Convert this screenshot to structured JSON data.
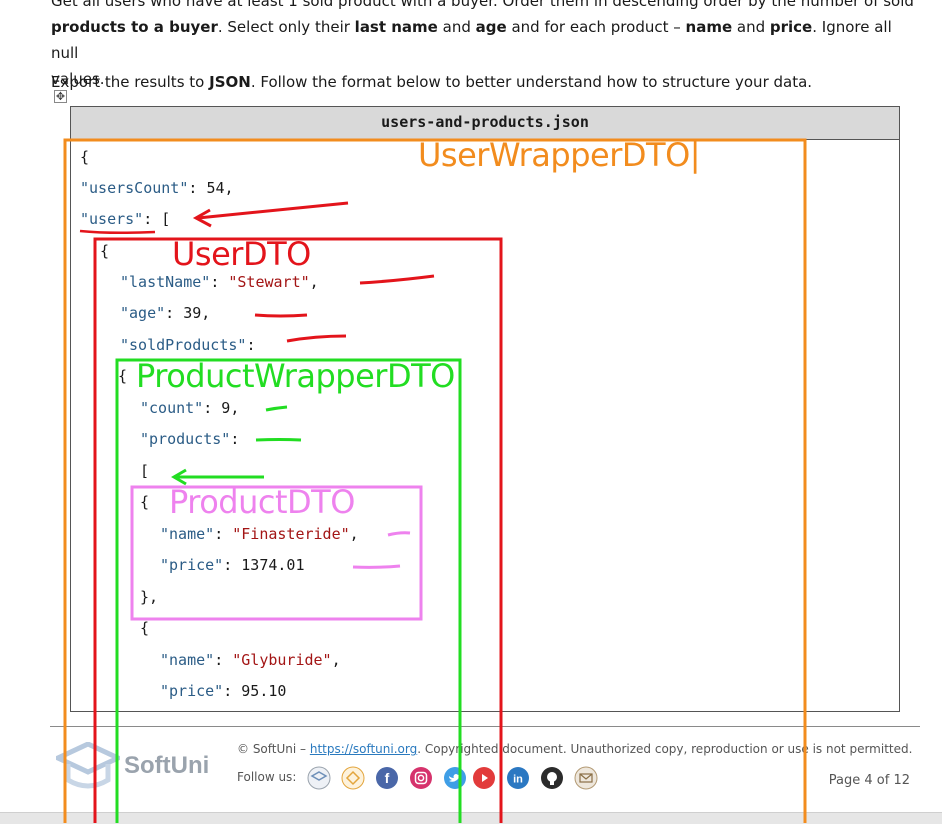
{
  "intro": {
    "line1_prefix": "Get all users who have at least 1 sold product with a buyer. Order them in descending order by the number of sold",
    "line2_bold": "products to a buyer",
    "line2_mid1": ". Select only their ",
    "bold_lastname": "last name",
    "mid2": " and ",
    "bold_age": "age",
    "mid3": " and for each product – ",
    "bold_name": "name",
    "mid4": " and ",
    "bold_price": "price",
    "line2_end": ". Ignore all null",
    "line3": "values."
  },
  "export": {
    "prefix": "Export the results to ",
    "bold": "JSON",
    "suffix": ". Follow the format below to better understand how to structure your data."
  },
  "move_handle_glyph": "✥",
  "code": {
    "filename": "users-and-products.json",
    "lines": {
      "l1": "{",
      "l2_key": "\"usersCount\"",
      "l2_val": "54",
      "l3_key": "\"users\"",
      "l3_rest": ": [",
      "l4": "{",
      "l5_key": "\"lastName\"",
      "l5_val": "\"Stewart\"",
      "l6_key": "\"age\"",
      "l6_val": "39",
      "l7_key": "\"soldProducts\"",
      "l8": "{",
      "l9_key": "\"count\"",
      "l9_val": "9",
      "l10_key": "\"products\"",
      "l11": "[",
      "l12": "{",
      "l13_key": "\"name\"",
      "l13_val": "\"Finasteride\"",
      "l14_key": "\"price\"",
      "l14_val": "1374.01",
      "l15": "},",
      "l16": "{",
      "l17_key": "\"name\"",
      "l17_val": "\"Glyburide\"",
      "l18_key": "\"price\"",
      "l18_val": "95.10"
    }
  },
  "annotations": {
    "user_wrapper": "UserWrapperDTO|",
    "user": "UserDTO",
    "product_wrapper": "ProductWrapperDTO",
    "product": "ProductDTO",
    "colors": {
      "orange": "#f28c1e",
      "red": "#e3141b",
      "green": "#22dd22",
      "pink": "#ee82ee"
    }
  },
  "footer": {
    "logo": "SoftUni",
    "copyright_prefix": "© SoftUni – ",
    "link": "https://softuni.org",
    "copyright_suffix": ". Copyrighted document. Unauthorized copy, reproduction or use is not permitted.",
    "follow": "Follow us:",
    "page": "Page 4 of 12",
    "social_icons": [
      "softuni-icon",
      "softuni-foundation-icon",
      "facebook-icon",
      "instagram-icon",
      "twitter-icon",
      "youtube-icon",
      "linkedin-icon",
      "github-icon",
      "email-icon"
    ]
  }
}
